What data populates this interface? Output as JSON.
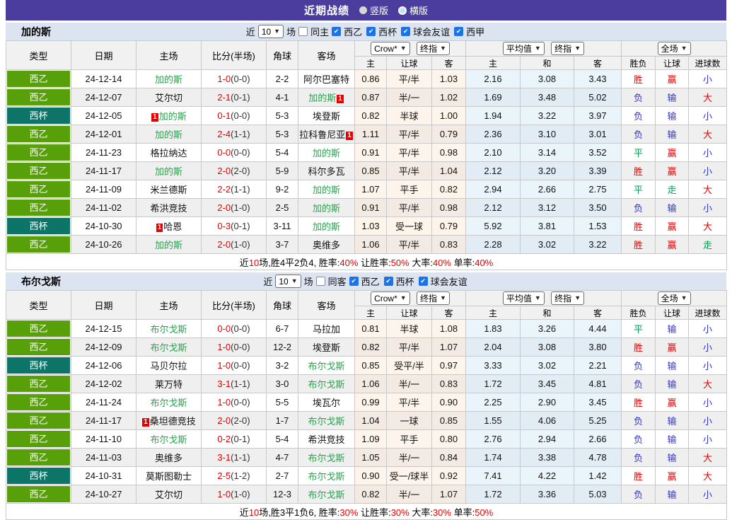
{
  "colors": {
    "topbar_purple": "#4b3d9e",
    "filter_bg": "#dbe4f0",
    "league_badge_green": "#57a00a",
    "cup_badge_teal": "#0d7468",
    "focus_team_green": "#2ba24e",
    "red": "#e60000",
    "blue": "#3333cc",
    "green": "#00a050",
    "checkbox_blue": "#1a73e8"
  },
  "title_bar": {
    "title": "近期战绩",
    "radio_vertical": "竖版",
    "radio_horizontal": "横版",
    "selected": "横版"
  },
  "columns": {
    "main": [
      "类型",
      "日期",
      "主场",
      "比分(半场)",
      "角球",
      "客场"
    ],
    "sub": [
      "主",
      "让球",
      "客",
      "主",
      "和",
      "客",
      "胜负",
      "让球",
      "进球数"
    ]
  },
  "tables": [
    {
      "team": "加的斯",
      "filter": {
        "near_label": "近",
        "count": "10",
        "games_label": "场",
        "same_label": "同主",
        "same_checked": false,
        "leagues": [
          "西乙",
          "西杯",
          "球会友谊",
          "西甲"
        ]
      },
      "selects": {
        "bookmaker": "Crow*",
        "bookmaker_state": "终指",
        "average": "平均值",
        "average_state": "终指",
        "scope": "全场"
      },
      "rows": [
        {
          "type": "西乙",
          "kind": "league",
          "date": "24-12-14",
          "home": {
            "name": "加的斯",
            "focus": true
          },
          "score_ft": "1-0",
          "score_ht": "(0-0)",
          "corner": "2-2",
          "away": {
            "name": "阿尔巴塞特",
            "focus": false
          },
          "crow": [
            "0.86",
            "平/半",
            "1.03"
          ],
          "avg": [
            "2.16",
            "3.08",
            "3.43"
          ],
          "result": [
            "胜",
            "赢",
            "小"
          ]
        },
        {
          "type": "西乙",
          "kind": "league",
          "date": "24-12-07",
          "home": {
            "name": "艾尔切",
            "focus": false
          },
          "score_ft": "2-1",
          "score_ht": "(0-1)",
          "corner": "4-1",
          "away": {
            "name": "加的斯",
            "focus": true,
            "badge": "1",
            "badge_pos": "after"
          },
          "crow": [
            "0.87",
            "半/一",
            "1.02"
          ],
          "avg": [
            "1.69",
            "3.48",
            "5.02"
          ],
          "result": [
            "负",
            "输",
            "大"
          ]
        },
        {
          "type": "西杯",
          "kind": "cup",
          "date": "24-12-05",
          "home": {
            "name": "加的斯",
            "focus": true,
            "badge": "1",
            "badge_pos": "before"
          },
          "score_ft": "0-1",
          "score_ht": "(0-0)",
          "corner": "5-3",
          "away": {
            "name": "埃登斯",
            "focus": false
          },
          "crow": [
            "0.82",
            "半球",
            "1.00"
          ],
          "avg": [
            "1.94",
            "3.22",
            "3.97"
          ],
          "result": [
            "负",
            "输",
            "小"
          ]
        },
        {
          "type": "西乙",
          "kind": "league",
          "date": "24-12-01",
          "home": {
            "name": "加的斯",
            "focus": true
          },
          "score_ft": "2-4",
          "score_ht": "(1-1)",
          "corner": "5-3",
          "away": {
            "name": "拉科鲁尼亚",
            "focus": false,
            "badge": "1",
            "badge_pos": "after"
          },
          "crow": [
            "1.11",
            "平/半",
            "0.79"
          ],
          "avg": [
            "2.36",
            "3.10",
            "3.01"
          ],
          "result": [
            "负",
            "输",
            "大"
          ]
        },
        {
          "type": "西乙",
          "kind": "league",
          "date": "24-11-23",
          "home": {
            "name": "格拉纳达",
            "focus": false
          },
          "score_ft": "0-0",
          "score_ht": "(0-0)",
          "corner": "5-4",
          "away": {
            "name": "加的斯",
            "focus": true
          },
          "crow": [
            "0.91",
            "平/半",
            "0.98"
          ],
          "avg": [
            "2.10",
            "3.14",
            "3.52"
          ],
          "result": [
            "平",
            "赢",
            "小"
          ]
        },
        {
          "type": "西乙",
          "kind": "league",
          "date": "24-11-17",
          "home": {
            "name": "加的斯",
            "focus": true
          },
          "score_ft": "2-0",
          "score_ht": "(2-0)",
          "corner": "5-9",
          "away": {
            "name": "科尔多瓦",
            "focus": false
          },
          "crow": [
            "0.85",
            "平/半",
            "1.04"
          ],
          "avg": [
            "2.12",
            "3.20",
            "3.39"
          ],
          "result": [
            "胜",
            "赢",
            "小"
          ]
        },
        {
          "type": "西乙",
          "kind": "league",
          "date": "24-11-09",
          "home": {
            "name": "米兰德斯",
            "focus": false
          },
          "score_ft": "2-2",
          "score_ht": "(1-1)",
          "corner": "9-2",
          "away": {
            "name": "加的斯",
            "focus": true
          },
          "crow": [
            "1.07",
            "平手",
            "0.82"
          ],
          "avg": [
            "2.94",
            "2.66",
            "2.75"
          ],
          "result": [
            "平",
            "走",
            "大"
          ]
        },
        {
          "type": "西乙",
          "kind": "league",
          "date": "24-11-02",
          "home": {
            "name": "希洪竞技",
            "focus": false
          },
          "score_ft": "2-0",
          "score_ht": "(1-0)",
          "corner": "2-5",
          "away": {
            "name": "加的斯",
            "focus": true
          },
          "crow": [
            "0.91",
            "平/半",
            "0.98"
          ],
          "avg": [
            "2.12",
            "3.12",
            "3.50"
          ],
          "result": [
            "负",
            "输",
            "小"
          ]
        },
        {
          "type": "西杯",
          "kind": "cup",
          "date": "24-10-30",
          "home": {
            "name": "哈恩",
            "focus": false,
            "badge": "1",
            "badge_pos": "before"
          },
          "score_ft": "0-3",
          "score_ht": "(0-1)",
          "corner": "3-11",
          "away": {
            "name": "加的斯",
            "focus": true
          },
          "crow": [
            "1.03",
            "受一球",
            "0.79"
          ],
          "avg": [
            "5.92",
            "3.81",
            "1.53"
          ],
          "result": [
            "胜",
            "赢",
            "大"
          ]
        },
        {
          "type": "西乙",
          "kind": "league",
          "date": "24-10-26",
          "home": {
            "name": "加的斯",
            "focus": true
          },
          "score_ft": "2-0",
          "score_ht": "(1-0)",
          "corner": "3-7",
          "away": {
            "name": "奥维多",
            "focus": false
          },
          "crow": [
            "1.06",
            "平/半",
            "0.83"
          ],
          "avg": [
            "2.28",
            "3.02",
            "3.22"
          ],
          "result": [
            "胜",
            "赢",
            "走"
          ]
        }
      ],
      "summary": [
        "近",
        "10",
        "场,胜4平2负4, 胜率:",
        "40%",
        " 让胜率:",
        "50%",
        " 大率:",
        "40%",
        " 单率:",
        "40%"
      ]
    },
    {
      "team": "布尔戈斯",
      "filter": {
        "near_label": "近",
        "count": "10",
        "games_label": "场",
        "same_label": "同客",
        "same_checked": false,
        "leagues": [
          "西乙",
          "西杯",
          "球会友谊"
        ]
      },
      "selects": {
        "bookmaker": "Crow*",
        "bookmaker_state": "终指",
        "average": "平均值",
        "average_state": "终指",
        "scope": "全场"
      },
      "rows": [
        {
          "type": "西乙",
          "kind": "league",
          "date": "24-12-15",
          "home": {
            "name": "布尔戈斯",
            "focus": true
          },
          "score_ft": "0-0",
          "score_ht": "(0-0)",
          "corner": "6-7",
          "away": {
            "name": "马拉加",
            "focus": false
          },
          "crow": [
            "0.81",
            "半球",
            "1.08"
          ],
          "avg": [
            "1.83",
            "3.26",
            "4.44"
          ],
          "result": [
            "平",
            "输",
            "小"
          ]
        },
        {
          "type": "西乙",
          "kind": "league",
          "date": "24-12-09",
          "home": {
            "name": "布尔戈斯",
            "focus": true
          },
          "score_ft": "1-0",
          "score_ht": "(0-0)",
          "corner": "12-2",
          "away": {
            "name": "埃登斯",
            "focus": false
          },
          "crow": [
            "0.82",
            "平/半",
            "1.07"
          ],
          "avg": [
            "2.04",
            "3.08",
            "3.80"
          ],
          "result": [
            "胜",
            "赢",
            "小"
          ]
        },
        {
          "type": "西杯",
          "kind": "cup",
          "date": "24-12-06",
          "home": {
            "name": "马贝尔拉",
            "focus": false
          },
          "score_ft": "1-0",
          "score_ht": "(0-0)",
          "corner": "3-2",
          "away": {
            "name": "布尔戈斯",
            "focus": true
          },
          "crow": [
            "0.85",
            "受平/半",
            "0.97"
          ],
          "avg": [
            "3.33",
            "3.02",
            "2.21"
          ],
          "result": [
            "负",
            "输",
            "小"
          ]
        },
        {
          "type": "西乙",
          "kind": "league",
          "date": "24-12-02",
          "home": {
            "name": "莱万特",
            "focus": false
          },
          "score_ft": "3-1",
          "score_ht": "(1-1)",
          "corner": "3-0",
          "away": {
            "name": "布尔戈斯",
            "focus": true
          },
          "crow": [
            "1.06",
            "半/一",
            "0.83"
          ],
          "avg": [
            "1.72",
            "3.45",
            "4.81"
          ],
          "result": [
            "负",
            "输",
            "大"
          ]
        },
        {
          "type": "西乙",
          "kind": "league",
          "date": "24-11-24",
          "home": {
            "name": "布尔戈斯",
            "focus": true
          },
          "score_ft": "1-0",
          "score_ht": "(0-0)",
          "corner": "5-5",
          "away": {
            "name": "埃瓦尔",
            "focus": false
          },
          "crow": [
            "0.99",
            "平/半",
            "0.90"
          ],
          "avg": [
            "2.25",
            "2.90",
            "3.45"
          ],
          "result": [
            "胜",
            "赢",
            "小"
          ]
        },
        {
          "type": "西乙",
          "kind": "league",
          "date": "24-11-17",
          "home": {
            "name": "桑坦德竞技",
            "focus": false,
            "badge": "1",
            "badge_pos": "before"
          },
          "score_ft": "2-0",
          "score_ht": "(2-0)",
          "corner": "1-7",
          "away": {
            "name": "布尔戈斯",
            "focus": true
          },
          "crow": [
            "1.04",
            "一球",
            "0.85"
          ],
          "avg": [
            "1.55",
            "4.06",
            "5.25"
          ],
          "result": [
            "负",
            "输",
            "小"
          ]
        },
        {
          "type": "西乙",
          "kind": "league",
          "date": "24-11-10",
          "home": {
            "name": "布尔戈斯",
            "focus": true
          },
          "score_ft": "0-2",
          "score_ht": "(0-1)",
          "corner": "5-4",
          "away": {
            "name": "希洪竞技",
            "focus": false
          },
          "crow": [
            "1.09",
            "平手",
            "0.80"
          ],
          "avg": [
            "2.76",
            "2.94",
            "2.66"
          ],
          "result": [
            "负",
            "输",
            "小"
          ]
        },
        {
          "type": "西乙",
          "kind": "league",
          "date": "24-11-03",
          "home": {
            "name": "奥维多",
            "focus": false
          },
          "score_ft": "3-1",
          "score_ht": "(1-1)",
          "corner": "4-7",
          "away": {
            "name": "布尔戈斯",
            "focus": true
          },
          "crow": [
            "1.05",
            "半/一",
            "0.84"
          ],
          "avg": [
            "1.74",
            "3.38",
            "4.78"
          ],
          "result": [
            "负",
            "输",
            "大"
          ]
        },
        {
          "type": "西杯",
          "kind": "cup",
          "date": "24-10-31",
          "home": {
            "name": "莫斯图勒士",
            "focus": false
          },
          "score_ft": "2-5",
          "score_ht": "(1-2)",
          "corner": "2-7",
          "away": {
            "name": "布尔戈斯",
            "focus": true
          },
          "crow": [
            "0.90",
            "受一/球半",
            "0.92"
          ],
          "avg": [
            "7.41",
            "4.22",
            "1.42"
          ],
          "result": [
            "胜",
            "赢",
            "大"
          ]
        },
        {
          "type": "西乙",
          "kind": "league",
          "date": "24-10-27",
          "home": {
            "name": "艾尔切",
            "focus": false
          },
          "score_ft": "1-0",
          "score_ht": "(1-0)",
          "corner": "12-3",
          "away": {
            "name": "布尔戈斯",
            "focus": true
          },
          "crow": [
            "0.82",
            "半/一",
            "1.07"
          ],
          "avg": [
            "1.72",
            "3.36",
            "5.03"
          ],
          "result": [
            "负",
            "输",
            "小"
          ]
        }
      ],
      "summary": [
        "近",
        "10",
        "场,胜3平1负6, 胜率:",
        "30%",
        " 让胜率:",
        "30%",
        " 大率:",
        "30%",
        " 单率:",
        "50%"
      ]
    }
  ]
}
